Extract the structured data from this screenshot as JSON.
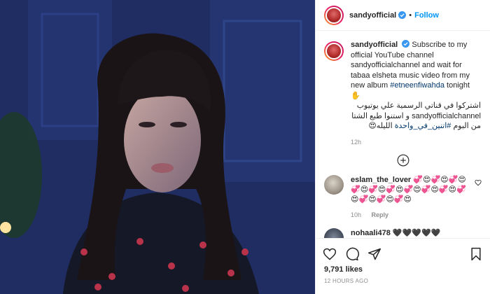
{
  "header": {
    "username": "sandyofficial",
    "follow_label": "Follow",
    "separator": "•"
  },
  "caption": {
    "username": "sandyofficial",
    "text_en": "Subscribe to my official YouTube channel sandyofficialchannel and wait for tabaa elsheta music video from my new album",
    "hashtag_en": "#etneenfiwahda",
    "text_en_end": "tonight ✋",
    "text_ar_1": "اشتركوا في قناتي الرسمية علي يوتيوب",
    "text_ar_2": "sandyofficialchannel و استنوا طبع الشتا",
    "text_ar_3_pre": "من البوم",
    "hashtag_ar": "#اتنين_في_واحدة",
    "text_ar_3_post": "الليله😍",
    "time": "12h"
  },
  "comments": [
    {
      "username": "eslam_the_lover",
      "text": "💞😍💞😍💞😍💞😍💞😍💞😍💞😍💞😍💞😍💞😍💞😍💞😍💞😍",
      "time": "10h",
      "reply_label": "Reply"
    },
    {
      "username": "nohaali478",
      "text": "🖤🖤🖤🖤🖤"
    }
  ],
  "footer": {
    "likes": "9,791 likes",
    "time": "12 HOURS AGO"
  },
  "icons": {
    "like": "heart-outline-icon",
    "comment": "comment-bubble-icon",
    "share": "paper-plane-icon",
    "save": "bookmark-icon",
    "load_more": "plus-circle-icon",
    "verified": "verified-badge-icon"
  },
  "colors": {
    "accent": "#0095f6",
    "hashtag": "#00376b",
    "muted": "#8e8e8e",
    "photo_tone": "#22356e"
  }
}
